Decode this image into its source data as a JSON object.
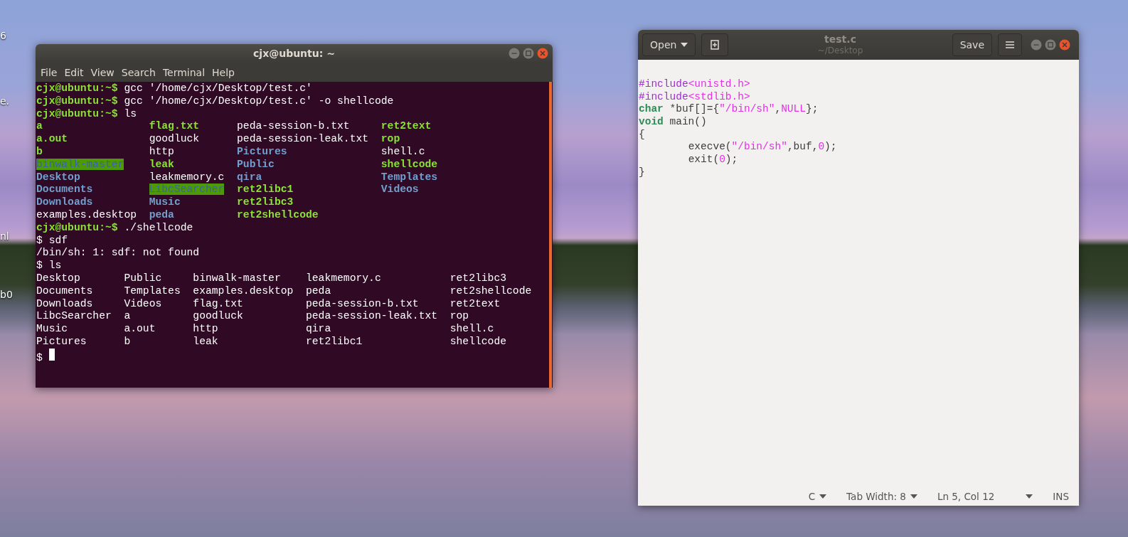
{
  "desktop": {
    "icon_labels": [
      "6",
      "e.",
      "nl",
      "b0"
    ]
  },
  "terminal": {
    "title": "cjx@ubuntu: ~",
    "menu": [
      "File",
      "Edit",
      "View",
      "Search",
      "Terminal",
      "Help"
    ],
    "lines": [
      {
        "kind": "prompt",
        "prompt": "cjx@ubuntu:~$",
        "command": "gcc '/home/cjx/Desktop/test.c'"
      },
      {
        "kind": "prompt",
        "prompt": "cjx@ubuntu:~$",
        "command": "gcc '/home/cjx/Desktop/test.c' -o shellcode"
      },
      {
        "kind": "prompt",
        "prompt": "cjx@ubuntu:~$",
        "command": "ls"
      },
      {
        "kind": "listing",
        "rows": [
          [
            {
              "name": "a",
              "kind": "exec"
            },
            {
              "name": "flag.txt",
              "kind": "exec"
            },
            {
              "name": "peda-session-b.txt",
              "kind": "file"
            },
            {
              "name": "ret2text",
              "kind": "exec"
            }
          ],
          [
            {
              "name": "a.out",
              "kind": "exec"
            },
            {
              "name": "goodluck",
              "kind": "file"
            },
            {
              "name": "peda-session-leak.txt",
              "kind": "file"
            },
            {
              "name": "rop",
              "kind": "exec"
            }
          ],
          [
            {
              "name": "b",
              "kind": "exec"
            },
            {
              "name": "http",
              "kind": "file"
            },
            {
              "name": "Pictures",
              "kind": "dir"
            },
            {
              "name": "shell.c",
              "kind": "file"
            }
          ],
          [
            {
              "name": "binwalk-master",
              "kind": "dir_highlight"
            },
            {
              "name": "leak",
              "kind": "exec"
            },
            {
              "name": "Public",
              "kind": "dir"
            },
            {
              "name": "shellcode",
              "kind": "exec"
            }
          ],
          [
            {
              "name": "Desktop",
              "kind": "dir"
            },
            {
              "name": "leakmemory.c",
              "kind": "file"
            },
            {
              "name": "qira",
              "kind": "dir"
            },
            {
              "name": "Templates",
              "kind": "dir"
            }
          ],
          [
            {
              "name": "Documents",
              "kind": "dir"
            },
            {
              "name": "LibcSearcher",
              "kind": "dir_highlight"
            },
            {
              "name": "ret2libc1",
              "kind": "exec"
            },
            {
              "name": "Videos",
              "kind": "dir"
            }
          ],
          [
            {
              "name": "Downloads",
              "kind": "dir"
            },
            {
              "name": "Music",
              "kind": "dir"
            },
            {
              "name": "ret2libc3",
              "kind": "exec"
            }
          ],
          [
            {
              "name": "examples.desktop",
              "kind": "file"
            },
            {
              "name": "peda",
              "kind": "dir"
            },
            {
              "name": "ret2shellcode",
              "kind": "exec"
            }
          ]
        ]
      },
      {
        "kind": "prompt",
        "prompt": "cjx@ubuntu:~$",
        "command": "./shellcode"
      },
      {
        "kind": "output",
        "text": "$ sdf"
      },
      {
        "kind": "output",
        "text": "/bin/sh: 1: sdf: not found"
      },
      {
        "kind": "output",
        "text": "$ ls"
      },
      {
        "kind": "listing",
        "rows": [
          [
            {
              "name": "Desktop",
              "kind": "file"
            },
            {
              "name": "Public",
              "kind": "file"
            },
            {
              "name": "binwalk-master",
              "kind": "file"
            },
            {
              "name": "leakmemory.c",
              "kind": "file"
            },
            {
              "name": "ret2libc3",
              "kind": "file"
            }
          ],
          [
            {
              "name": "Documents",
              "kind": "file"
            },
            {
              "name": "Templates",
              "kind": "file"
            },
            {
              "name": "examples.desktop",
              "kind": "file"
            },
            {
              "name": "peda",
              "kind": "file"
            },
            {
              "name": "ret2shellcode",
              "kind": "file"
            }
          ],
          [
            {
              "name": "Downloads",
              "kind": "file"
            },
            {
              "name": "Videos",
              "kind": "file"
            },
            {
              "name": "flag.txt",
              "kind": "file"
            },
            {
              "name": "peda-session-b.txt",
              "kind": "file"
            },
            {
              "name": "ret2text",
              "kind": "file"
            }
          ],
          [
            {
              "name": "LibcSearcher",
              "kind": "file"
            },
            {
              "name": "a",
              "kind": "file"
            },
            {
              "name": "goodluck",
              "kind": "file"
            },
            {
              "name": "peda-session-leak.txt",
              "kind": "file"
            },
            {
              "name": "rop",
              "kind": "file"
            }
          ],
          [
            {
              "name": "Music",
              "kind": "file"
            },
            {
              "name": "a.out",
              "kind": "file"
            },
            {
              "name": "http",
              "kind": "file"
            },
            {
              "name": "qira",
              "kind": "file"
            },
            {
              "name": "shell.c",
              "kind": "file"
            }
          ],
          [
            {
              "name": "Pictures",
              "kind": "file"
            },
            {
              "name": "b",
              "kind": "file"
            },
            {
              "name": "leak",
              "kind": "file"
            },
            {
              "name": "ret2libc1",
              "kind": "file"
            },
            {
              "name": "shellcode",
              "kind": "file"
            }
          ]
        ]
      },
      {
        "kind": "cursor",
        "text": "$"
      }
    ]
  },
  "editor": {
    "open_button": "Open",
    "title": "test.c",
    "subtitle": "~/Desktop",
    "save_button": "Save",
    "code": [
      [
        {
          "t": "#include",
          "kind": "preproc"
        },
        {
          "t": "<unistd.h>",
          "kind": "string"
        }
      ],
      [
        {
          "t": "#include",
          "kind": "preproc"
        },
        {
          "t": "<stdlib.h>",
          "kind": "string"
        }
      ],
      [
        {
          "t": "char",
          "kind": "keyword"
        },
        {
          "t": " *buf[]={",
          "kind": "plain"
        },
        {
          "t": "\"/bin/sh\"",
          "kind": "string"
        },
        {
          "t": ",",
          "kind": "plain"
        },
        {
          "t": "NULL",
          "kind": "string"
        },
        {
          "t": "};",
          "kind": "plain"
        }
      ],
      [
        {
          "t": "void",
          "kind": "keyword"
        },
        {
          "t": " main()",
          "kind": "plain"
        }
      ],
      [
        {
          "t": "{",
          "kind": "plain"
        }
      ],
      [
        {
          "t": "\texecve(",
          "kind": "plain"
        },
        {
          "t": "\"/bin/sh\"",
          "kind": "string"
        },
        {
          "t": ",buf,",
          "kind": "plain"
        },
        {
          "t": "0",
          "kind": "string"
        },
        {
          "t": ");",
          "kind": "plain"
        }
      ],
      [
        {
          "t": "\texit(",
          "kind": "plain"
        },
        {
          "t": "0",
          "kind": "string"
        },
        {
          "t": ");",
          "kind": "plain"
        }
      ],
      [
        {
          "t": "}",
          "kind": "plain"
        }
      ]
    ],
    "status": {
      "language": "C",
      "tab_width": "Tab Width: 8",
      "position": "Ln 5, Col 12",
      "mode": "INS"
    }
  }
}
